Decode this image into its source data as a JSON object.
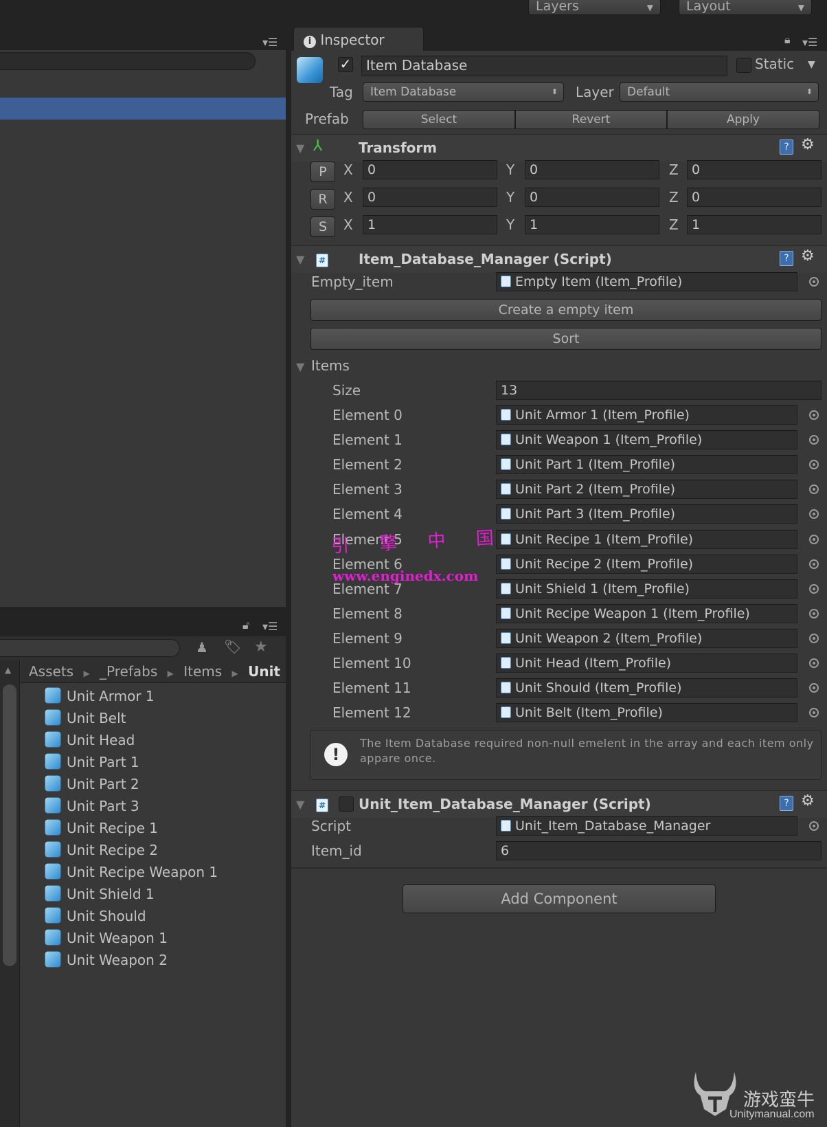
{
  "toolbar": {
    "layers": "Layers",
    "layout": "Layout"
  },
  "project": {
    "breadcrumb": [
      "Assets",
      "_Prefabs",
      "Items",
      "Unit"
    ],
    "items": [
      "Unit Armor 1",
      "Unit Belt",
      "Unit Head",
      "Unit Part 1",
      "Unit Part 2",
      "Unit Part 3",
      "Unit Recipe 1",
      "Unit Recipe 2",
      "Unit Recipe Weapon 1",
      "Unit Shield 1",
      "Unit Should",
      "Unit Weapon 1",
      "Unit Weapon 2"
    ]
  },
  "inspector": {
    "tab": "Inspector",
    "name": "Item Database",
    "active": true,
    "static_label": "Static",
    "static": false,
    "tag_label": "Tag",
    "tag": "Item Database",
    "layer_label": "Layer",
    "layer": "Default",
    "prefab_label": "Prefab",
    "prefab_buttons": [
      "Select",
      "Revert",
      "Apply"
    ],
    "transform": {
      "title": "Transform",
      "rows": [
        {
          "btn": "P",
          "x": "0",
          "y": "0",
          "z": "0"
        },
        {
          "btn": "R",
          "x": "0",
          "y": "0",
          "z": "0"
        },
        {
          "btn": "S",
          "x": "1",
          "y": "1",
          "z": "1"
        }
      ],
      "axis": {
        "x": "X",
        "y": "Y",
        "z": "Z"
      }
    },
    "script1": {
      "title": "Item_Database_Manager (Script)",
      "empty_item_label": "Empty_item",
      "empty_item": "Empty Item (Item_Profile)",
      "create_button": "Create a empty item",
      "sort_button": "Sort",
      "items_label": "Items",
      "size_label": "Size",
      "size": "13",
      "elements": [
        {
          "label": "Element 0",
          "value": "Unit Armor 1 (Item_Profile)"
        },
        {
          "label": "Element 1",
          "value": "Unit Weapon 1 (Item_Profile)"
        },
        {
          "label": "Element 2",
          "value": "Unit Part 1 (Item_Profile)"
        },
        {
          "label": "Element 3",
          "value": "Unit Part 2 (Item_Profile)"
        },
        {
          "label": "Element 4",
          "value": "Unit Part 3 (Item_Profile)"
        },
        {
          "label": "Element 5",
          "value": "Unit Recipe 1 (Item_Profile)"
        },
        {
          "label": "Element 6",
          "value": "Unit Recipe 2 (Item_Profile)"
        },
        {
          "label": "Element 7",
          "value": "Unit Shield 1 (Item_Profile)"
        },
        {
          "label": "Element 8",
          "value": "Unit Recipe Weapon 1 (Item_Profile)"
        },
        {
          "label": "Element 9",
          "value": "Unit Weapon 2 (Item_Profile)"
        },
        {
          "label": "Element 10",
          "value": "Unit Head (Item_Profile)"
        },
        {
          "label": "Element 11",
          "value": "Unit Should (Item_Profile)"
        },
        {
          "label": "Element 12",
          "value": "Unit Belt (Item_Profile)"
        }
      ],
      "help": "The Item Database required non-null emelent in the array and each item only appare once."
    },
    "script2": {
      "title": "Unit_Item_Database_Manager (Script)",
      "enabled": false,
      "script_label": "Script",
      "script": "Unit_Item_Database_Manager",
      "item_id_label": "Item_id",
      "item_id": "6"
    },
    "add_component": "Add Component"
  },
  "watermarks": {
    "engine_cn": "引 擎 中 国",
    "engine_url": "www.enginedx.com",
    "logo_cn": "游戏蛮牛",
    "logo_url": "Unitymanual.com"
  }
}
